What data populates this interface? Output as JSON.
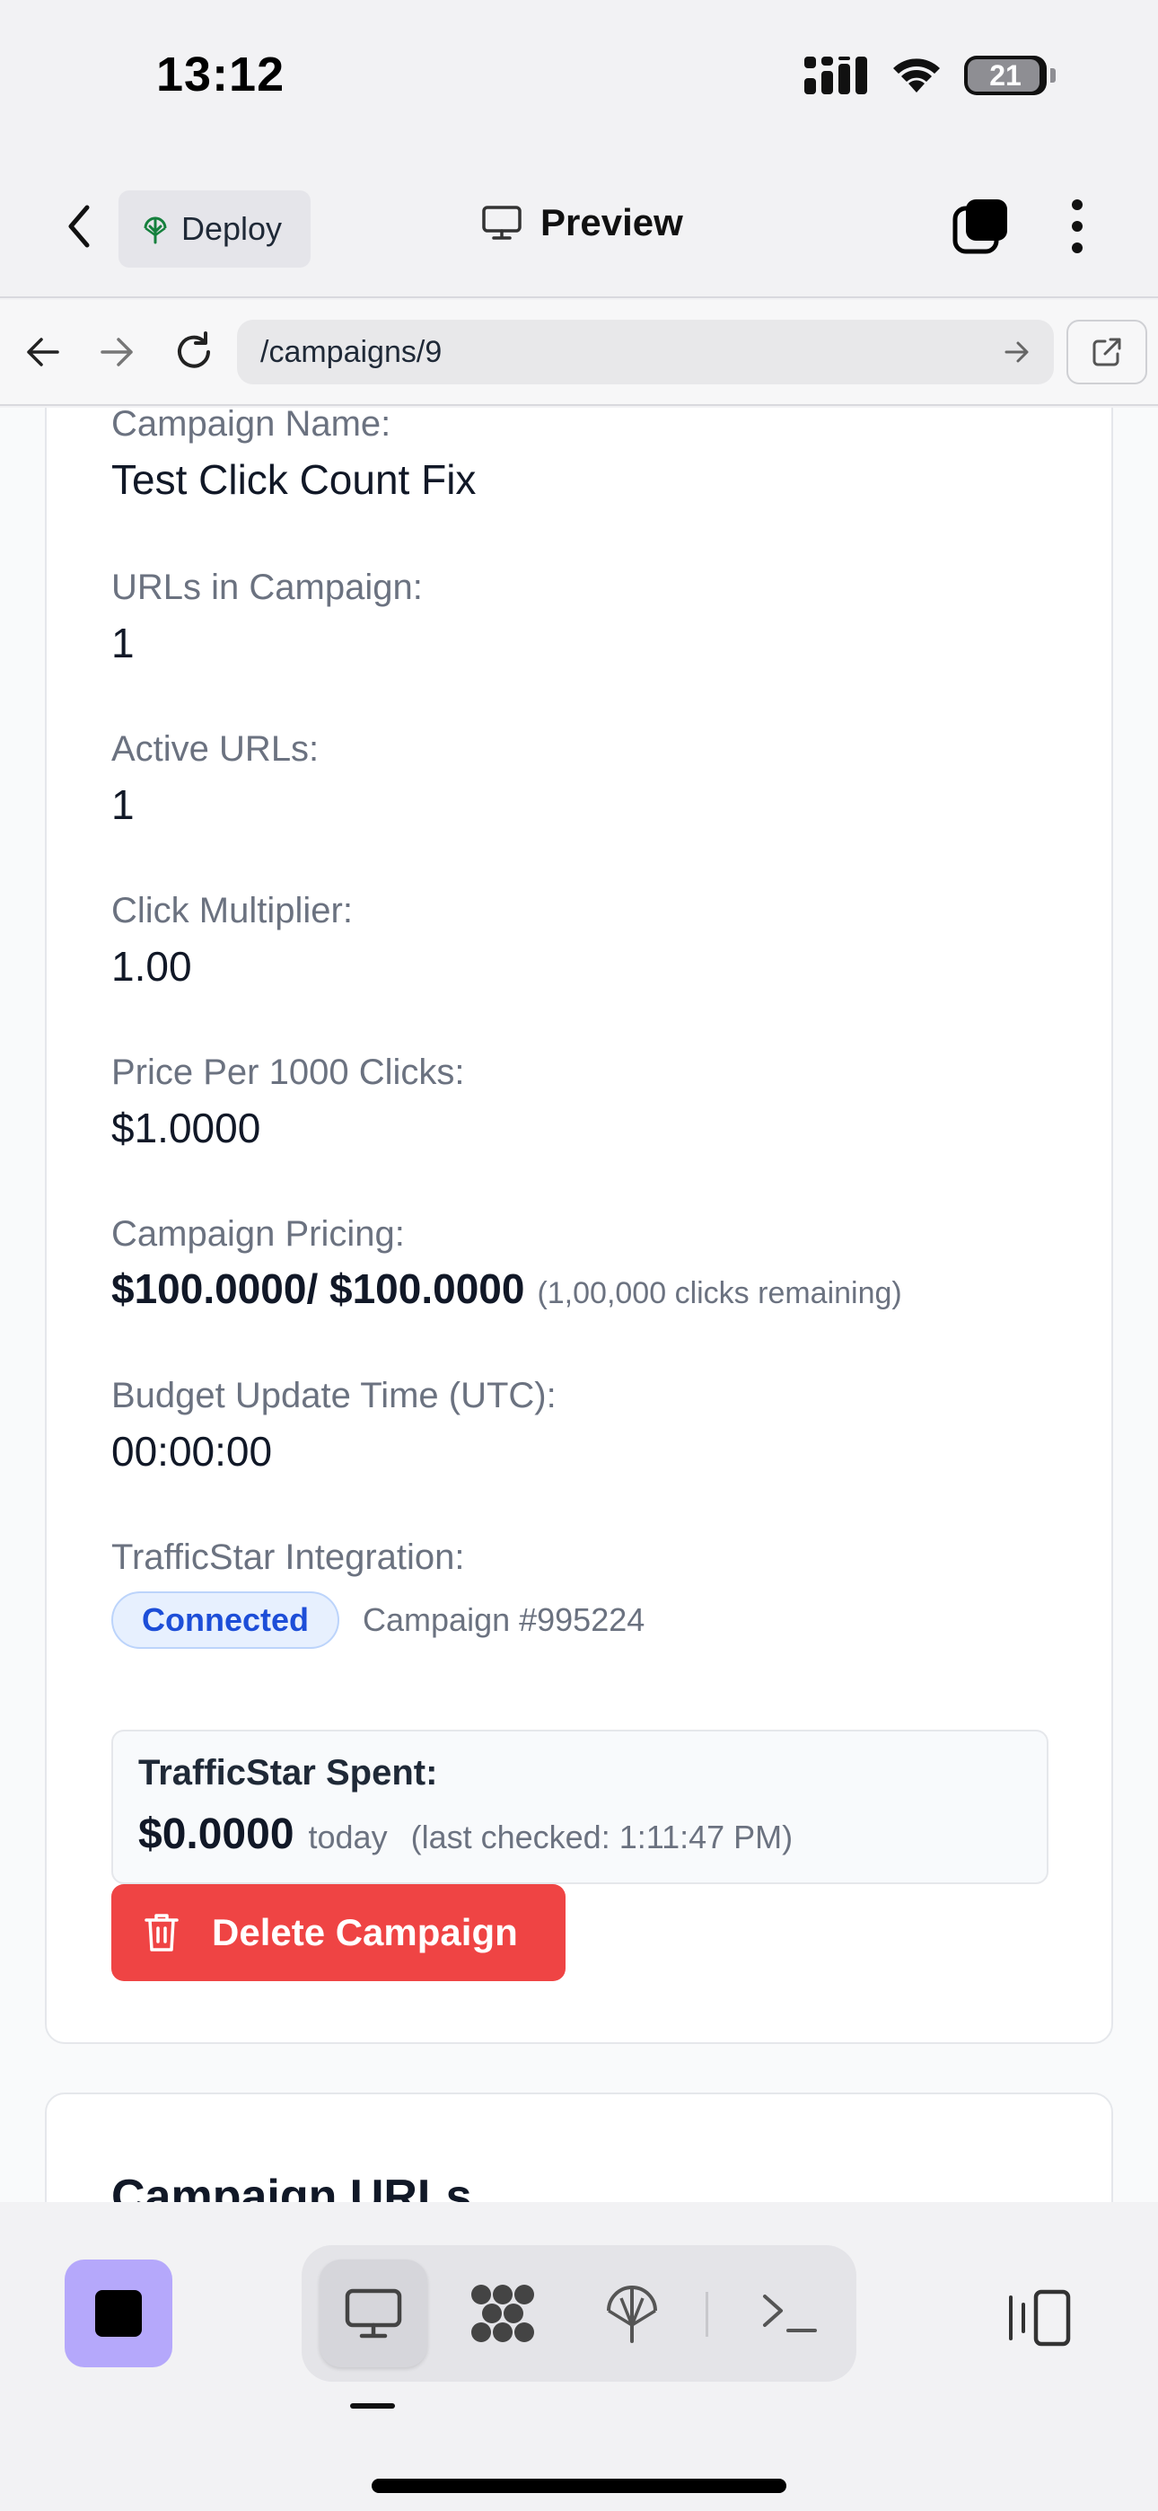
{
  "status_bar": {
    "time": "13:12",
    "battery": "21"
  },
  "toolbar": {
    "deploy_label": "Deploy",
    "preview_label": "Preview"
  },
  "url_bar": {
    "url": "/campaigns/9"
  },
  "campaign": {
    "name_label": "Campaign Name:",
    "name": "Test Click Count Fix",
    "urls_label": "URLs in Campaign:",
    "urls_count": "1",
    "active_label": "Active URLs:",
    "active_count": "1",
    "multiplier_label": "Click Multiplier:",
    "multiplier": "1.00",
    "price_label": "Price Per 1000 Clicks:",
    "price": "$1.0000",
    "pricing_label": "Campaign Pricing:",
    "pricing": "$100.0000/ $100.0000",
    "pricing_note": "(1,00,000 clicks remaining)",
    "budget_label": "Budget Update Time (UTC):",
    "budget_time": "00:00:00",
    "trafficstar_label": "TrafficStar Integration:",
    "trafficstar_status": "Connected",
    "trafficstar_campaign": "Campaign #995224",
    "spent_label": "TrafficStar Spent:",
    "spent_value": "$0.0000",
    "spent_period": "today",
    "spent_checked": "(last checked: 1:11:47 PM)",
    "delete_label": "Delete Campaign"
  },
  "urls_section": {
    "title": "Campaign URLs"
  },
  "colors": {
    "accent_purple": "#b5a8fb",
    "danger": "#ef4444",
    "badge_blue": "#1d4ed8"
  }
}
